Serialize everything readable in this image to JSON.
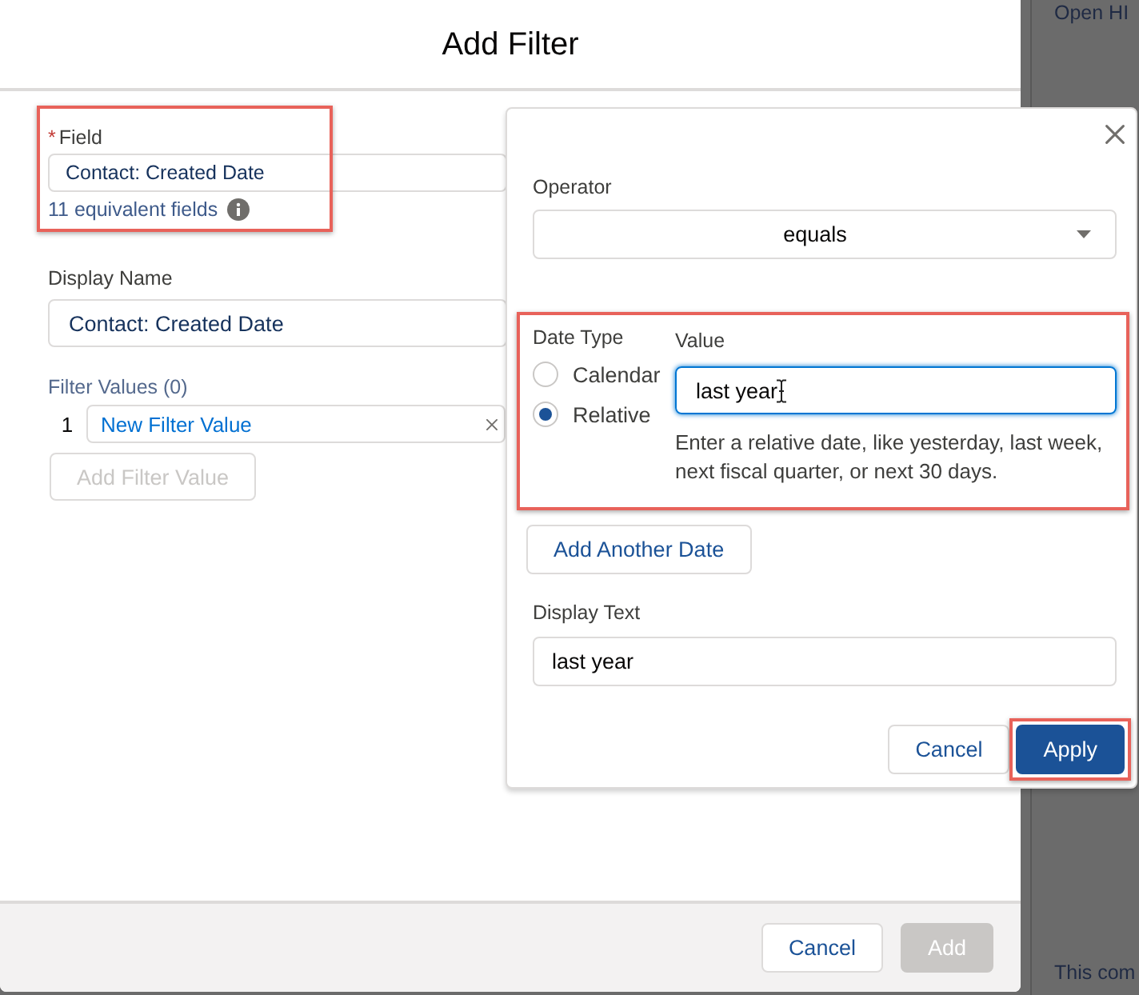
{
  "modal": {
    "title": "Add Filter"
  },
  "field": {
    "required_mark": "*",
    "label": "Field",
    "value": "Contact: Created Date",
    "hint": "11 equivalent fields",
    "highlighted": true
  },
  "display_name": {
    "label": "Display Name",
    "value": "Contact: Created Date"
  },
  "filter_values": {
    "label": "Filter Values (0)",
    "items": [
      {
        "number": "1",
        "value": "New Filter Value"
      }
    ],
    "add_button": {
      "label": "Add Filter Value",
      "disabled": true
    }
  },
  "popover": {
    "operator": {
      "label": "Operator",
      "value": "equals"
    },
    "date_section": {
      "highlighted": true,
      "date_type_label": "Date Type",
      "date_types": [
        {
          "label": "Calendar",
          "selected": false
        },
        {
          "label": "Relative",
          "selected": true
        }
      ],
      "value_label": "Value",
      "value": "last year",
      "value_focused": true,
      "help": "Enter a relative date, like yesterday, last week, next fiscal quarter, or next 30 days."
    },
    "add_date_button": "Add Another Date",
    "display_text": {
      "label": "Display Text",
      "value": "last year"
    },
    "buttons": [
      {
        "label": "Cancel",
        "kind": "neutral",
        "highlighted": false
      },
      {
        "label": "Apply",
        "kind": "brand",
        "highlighted": true
      }
    ]
  },
  "footer": {
    "buttons": [
      {
        "label": "Cancel",
        "kind": "neutral",
        "disabled": false
      },
      {
        "label": "Add",
        "kind": "brand",
        "disabled": true
      }
    ]
  },
  "background": {
    "texts": [
      "Open HI",
      "This com"
    ]
  }
}
